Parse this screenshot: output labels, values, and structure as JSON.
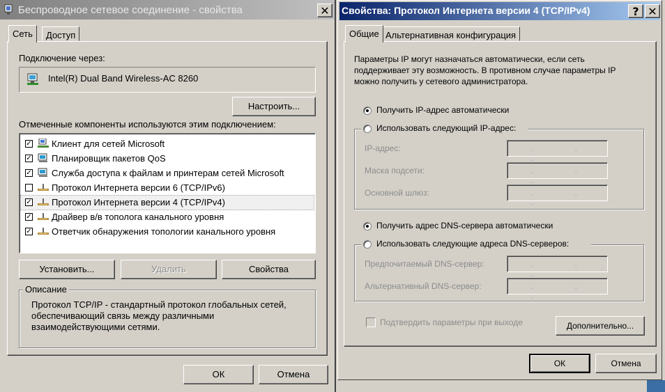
{
  "left_window": {
    "title": "Беспроводное сетевое соединение - свойства",
    "close_glyph": "✕",
    "tabs": [
      {
        "label": "Сеть"
      },
      {
        "label": "Доступ"
      }
    ],
    "connect_via_label": "Подключение через:",
    "adapter_name": "Intel(R) Dual Band Wireless-AC 8260",
    "configure_button": "Настроить...",
    "components_label": "Отмеченные компоненты используются этим подключением:",
    "components": [
      {
        "label": "Клиент для сетей Microsoft",
        "checked": true,
        "icon": "network-client-icon"
      },
      {
        "label": "Планировщик пакетов QoS",
        "checked": true,
        "icon": "service-icon"
      },
      {
        "label": "Служба доступа к файлам и принтерам сетей Microsoft",
        "checked": true,
        "icon": "service-icon"
      },
      {
        "label": "Протокол Интернета версии 6 (TCP/IPv6)",
        "checked": false,
        "icon": "protocol-icon"
      },
      {
        "label": "Протокол Интернета версии 4 (TCP/IPv4)",
        "checked": true,
        "icon": "protocol-icon"
      },
      {
        "label": "Драйвер в/в тополога канального уровня",
        "checked": true,
        "icon": "protocol-icon"
      },
      {
        "label": "Ответчик обнаружения топологии канального уровня",
        "checked": true,
        "icon": "protocol-icon"
      }
    ],
    "install_button": "Установить...",
    "remove_button": "Удалить",
    "properties_button": "Свойства",
    "description_title": "Описание",
    "description_text": "Протокол TCP/IP - стандартный протокол глобальных сетей, обеспечивающий связь между различными взаимодействующими сетями.",
    "ok_button": "ОК",
    "cancel_button": "Отмена"
  },
  "right_window": {
    "title": "Свойства: Протокол Интернета версии 4 (TCP/IPv4)",
    "help_glyph": "?",
    "close_glyph": "✕",
    "tabs": [
      {
        "label": "Общие"
      },
      {
        "label": "Альтернативная конфигурация"
      }
    ],
    "info_text": "Параметры IP могут назначаться автоматически, если сеть поддерживает эту возможность. В противном случае параметры IP можно получить у сетевого администратора.",
    "ip_auto_label": "Получить IP-адрес автоматически",
    "ip_manual_label": "Использовать следующий IP-адрес:",
    "ip_address_label": "IP-адрес:",
    "subnet_label": "Маска подсети:",
    "gateway_label": "Основной шлюз:",
    "ip_placeholder": ". . .",
    "dns_auto_label": "Получить адрес DNS-сервера автоматически",
    "dns_manual_label": "Использовать следующие адреса DNS-серверов:",
    "preferred_dns_label": "Предпочитаемый DNS-сервер:",
    "alternate_dns_label": "Альтернативный DNS-сервер:",
    "validate_label": "Подтвердить параметры при выходе",
    "advanced_button": "Дополнительно...",
    "ok_button": "ОК",
    "cancel_button": "Отмена",
    "ip_mode": "auto",
    "dns_mode": "auto"
  },
  "colors": {
    "active_title_start": "#0a246a",
    "active_title_end": "#a6caf0",
    "inactive_title_start": "#808080",
    "inactive_title_end": "#c0c0c0",
    "face": "#d4d0c8"
  }
}
